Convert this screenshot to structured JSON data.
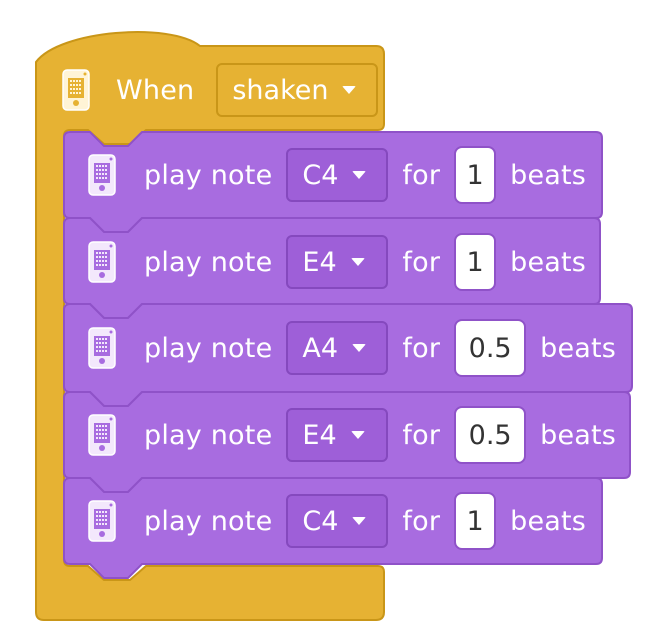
{
  "hat_block": {
    "label": "When",
    "event_value": "shaken",
    "icon": "device-icon",
    "color": "#e6b233",
    "border_color": "#c99618"
  },
  "note_blocks": [
    {
      "label": "play note",
      "note": "C4",
      "for_label": "for",
      "beats": "1",
      "beats_label": "beats"
    },
    {
      "label": "play note",
      "note": "E4",
      "for_label": "for",
      "beats": "1",
      "beats_label": "beats"
    },
    {
      "label": "play note",
      "note": "A4",
      "for_label": "for",
      "beats": "0.5",
      "beats_label": "beats"
    },
    {
      "label": "play note",
      "note": "E4",
      "for_label": "for",
      "beats": "0.5",
      "beats_label": "beats"
    },
    {
      "label": "play note",
      "note": "C4",
      "for_label": "for",
      "beats": "1",
      "beats_label": "beats"
    }
  ],
  "colors": {
    "note_block": "#a86ce0",
    "note_block_border": "#8f52c8",
    "dropdown": "#9e5fd8",
    "text": "#ffffff"
  }
}
